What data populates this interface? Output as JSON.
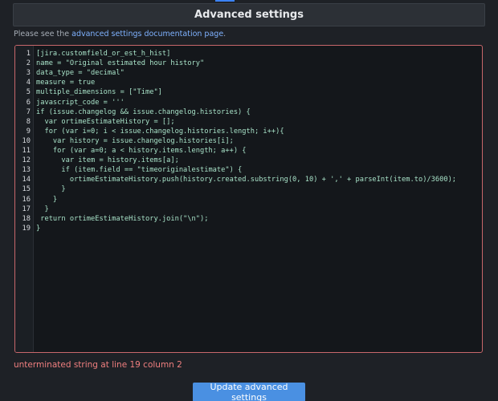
{
  "header": {
    "title": "Advanced settings"
  },
  "doc_line": {
    "prefix": "Please see the ",
    "link_text": "advanced settings documentation page",
    "suffix": "."
  },
  "editor": {
    "lines": [
      {
        "n": "1",
        "text": "[jira.customfield_or_est_h_hist]"
      },
      {
        "n": "2",
        "text": "name = \"Original estimated hour history\""
      },
      {
        "n": "3",
        "text": "data_type = \"decimal\""
      },
      {
        "n": "4",
        "text": "measure = true"
      },
      {
        "n": "5",
        "text": "multiple_dimensions = [\"Time\"]"
      },
      {
        "n": "6",
        "text": "javascript_code = '''"
      },
      {
        "n": "7",
        "text": "if (issue.changelog && issue.changelog.histories) {"
      },
      {
        "n": "8",
        "text": "  var ortimeEstimateHistory = [];"
      },
      {
        "n": "9",
        "text": "  for (var i=0; i < issue.changelog.histories.length; i++){"
      },
      {
        "n": "10",
        "text": "    var history = issue.changelog.histories[i];"
      },
      {
        "n": "11",
        "text": "    for (var a=0; a < history.items.length; a++) {"
      },
      {
        "n": "12",
        "text": "      var item = history.items[a];"
      },
      {
        "n": "13",
        "text": "      if (item.field == \"timeoriginalestimate\") {"
      },
      {
        "n": "14",
        "text": "        ortimeEstimateHistory.push(history.created.substring(0, 10) + ',' + parseInt(item.to)/3600);"
      },
      {
        "n": "15",
        "text": "      }"
      },
      {
        "n": "16",
        "text": "    }"
      },
      {
        "n": "17",
        "text": "  }"
      },
      {
        "n": "18",
        "text": " return ortimeEstimateHistory.join(\"\\n\");"
      },
      {
        "n": "19",
        "text": "}"
      }
    ]
  },
  "error": {
    "message": "unterminated string at line 19 column 2"
  },
  "update_button": {
    "label": "Update advanced settings"
  },
  "colors": {
    "background": "#1e2126",
    "header_bg": "#2c3036",
    "editor_bg": "#14171b",
    "editor_border": "#c8676b",
    "code_text": "#a7e1c7",
    "link": "#7fb2ff",
    "error_text": "#f07f7f",
    "button_bg": "#4a90e2"
  }
}
